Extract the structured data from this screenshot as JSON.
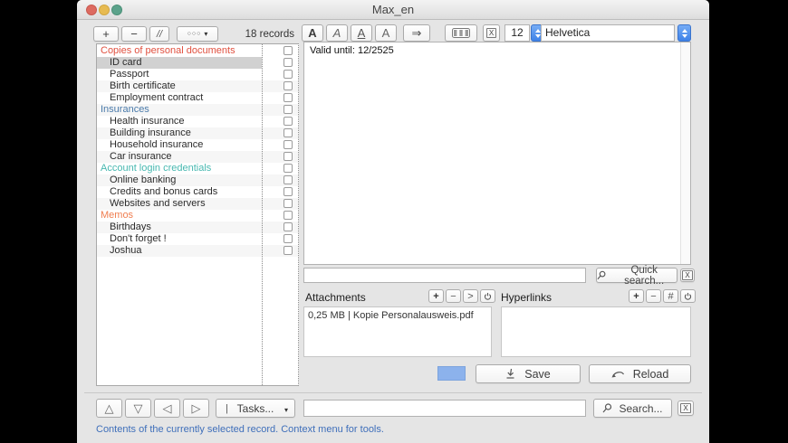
{
  "window": {
    "title": "Max_en"
  },
  "colors": {
    "accent_blue": "#8cb2ec",
    "selection_gray": "#d1d1d1",
    "status_text": "#3f6fba"
  },
  "toolbar": {
    "add_label": "+",
    "remove_label": "−",
    "slashes_label": "//",
    "options_dots": "○○○",
    "options_caret": "▾",
    "records_count": "18 records",
    "bold_label": "A",
    "italic_label": "A",
    "underline_label": "A",
    "plain_label": "A",
    "arrow_glyph": "⇒",
    "clear_format_label": "X",
    "font_size": "12",
    "font_name": "Helvetica"
  },
  "sidebar": {
    "rows": [
      {
        "label": "Copies of personal documents",
        "type": "category",
        "color": "#e0503f"
      },
      {
        "label": "ID card",
        "type": "item",
        "selected": true
      },
      {
        "label": "Passport",
        "type": "item"
      },
      {
        "label": "Birth certificate",
        "type": "item"
      },
      {
        "label": "Employment contract",
        "type": "item"
      },
      {
        "label": "Insurances",
        "type": "category",
        "color": "#4a7aaa"
      },
      {
        "label": "Health insurance",
        "type": "item"
      },
      {
        "label": "Building insurance",
        "type": "item"
      },
      {
        "label": "Household insurance",
        "type": "item"
      },
      {
        "label": "Car insurance",
        "type": "item"
      },
      {
        "label": "Account login credentials",
        "type": "category",
        "color": "#47b8b0"
      },
      {
        "label": "Online banking",
        "type": "item"
      },
      {
        "label": "Credits and bonus cards",
        "type": "item"
      },
      {
        "label": "Websites and servers",
        "type": "item"
      },
      {
        "label": "Memos",
        "type": "category",
        "color": "#f07e50"
      },
      {
        "label": "Birthdays",
        "type": "item"
      },
      {
        "label": "Don't forget !",
        "type": "item"
      },
      {
        "label": "Joshua",
        "type": "item"
      }
    ]
  },
  "editor": {
    "content": "Valid until: 12/2525"
  },
  "quick_search": {
    "input_value": "",
    "button_label": "Quick search...",
    "clear_label": "X"
  },
  "attachments": {
    "title": "Attachments",
    "toolbar": [
      {
        "name": "attachments-add-button",
        "glyph": "+"
      },
      {
        "name": "attachments-remove-button",
        "glyph": "−"
      },
      {
        "name": "attachments-open-button",
        "glyph": ">"
      },
      {
        "name": "attachments-action-button",
        "glyph": "power"
      }
    ],
    "items": [
      "0,25 MB | Kopie Personalausweis.pdf"
    ]
  },
  "hyperlinks": {
    "title": "Hyperlinks",
    "toolbar": [
      {
        "name": "hyperlinks-add-button",
        "glyph": "+"
      },
      {
        "name": "hyperlinks-remove-button",
        "glyph": "−"
      },
      {
        "name": "hyperlinks-number-button",
        "glyph": "#"
      },
      {
        "name": "hyperlinks-action-button",
        "glyph": "power"
      }
    ],
    "items": []
  },
  "actions": {
    "save_label": "Save",
    "reload_label": "Reload"
  },
  "footer": {
    "nav": [
      {
        "name": "nav-up-button",
        "glyph": "△"
      },
      {
        "name": "nav-down-button",
        "glyph": "▽"
      },
      {
        "name": "nav-left-button",
        "glyph": "◁"
      },
      {
        "name": "nav-right-button",
        "glyph": "▷"
      }
    ],
    "tasks_pipe": "|",
    "tasks_label": "Tasks...",
    "tasks_caret": "▾",
    "search_input_value": "",
    "search_label": "Search...",
    "clear_label": "X"
  },
  "status": {
    "message": "Contents of the currently selected record. Context menu for tools."
  }
}
